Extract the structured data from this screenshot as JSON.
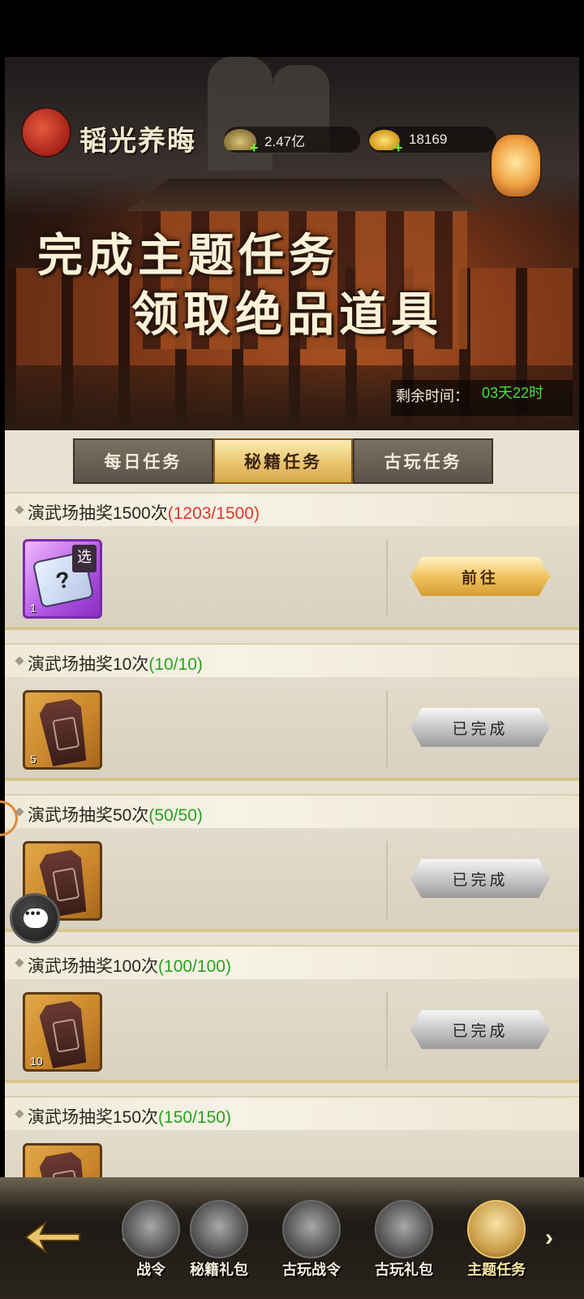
{
  "header": {
    "player_name": "韬光养晦",
    "coins": "2.47亿",
    "gold": "18169",
    "headline_line1": "完成主题任务",
    "headline_line2": "领取绝品道具",
    "timer_label": "剩余时间：",
    "timer_value": "03天22时"
  },
  "tabs": [
    {
      "label": "每日任务",
      "active": false
    },
    {
      "label": "秘籍任务",
      "active": true
    },
    {
      "label": "古玩任务",
      "active": false
    }
  ],
  "tasks": [
    {
      "title": "演武场抽奖1500次",
      "progress": "(1203/1500)",
      "progress_color": "#e0362c",
      "reward_count": "1",
      "button": "前往",
      "state": "go"
    },
    {
      "title": "演武场抽奖10次",
      "progress": "(10/10)",
      "progress_color": "#27a21e",
      "reward_count": "5",
      "button": "已完成",
      "state": "done"
    },
    {
      "title": "演武场抽奖50次",
      "progress": "(50/50)",
      "progress_color": "#27a21e",
      "reward_count": "",
      "button": "已完成",
      "state": "done"
    },
    {
      "title": "演武场抽奖100次",
      "progress": "(100/100)",
      "progress_color": "#27a21e",
      "reward_count": "10",
      "button": "已完成",
      "state": "done"
    },
    {
      "title": "演武场抽奖150次",
      "progress": "(150/150)",
      "progress_color": "#27a21e",
      "reward_count": "",
      "button": "",
      "state": "partial"
    }
  ],
  "reward_tag": "选",
  "bottom_nav": [
    {
      "label": "战令",
      "icon": "token-icon"
    },
    {
      "label": "秘籍礼包",
      "icon": "chest-icon"
    },
    {
      "label": "古玩战令",
      "icon": "vase-icon"
    },
    {
      "label": "古玩礼包",
      "icon": "chest-icon"
    },
    {
      "label": "主题任务",
      "icon": "scroll-icon"
    }
  ],
  "colors": {
    "accent_gold": "#e8c16a",
    "progress_red": "#e0362c",
    "progress_green": "#27a21e",
    "timer_green": "#45e23a"
  }
}
